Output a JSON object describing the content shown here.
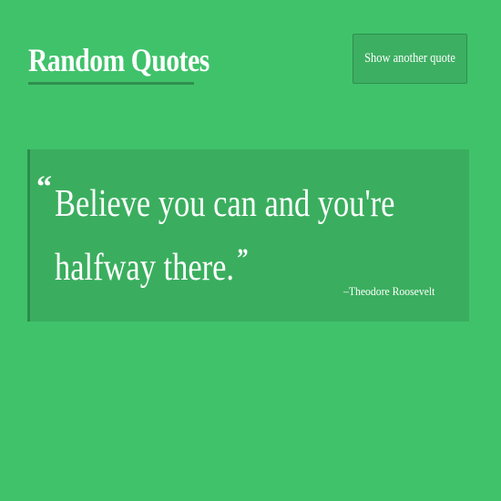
{
  "header": {
    "title": "Random Quotes"
  },
  "toolbar": {
    "new_quote_label": "Show another quote"
  },
  "quote": {
    "open_mark": "“",
    "text": "Believe you can and you're halfway there.",
    "close_mark": "”",
    "author": "–Theodore Roosevelt"
  },
  "colors": {
    "background": "#40c26b",
    "card": "#3aae5e",
    "accent": "#2c8d4a",
    "text": "#ffffff"
  }
}
